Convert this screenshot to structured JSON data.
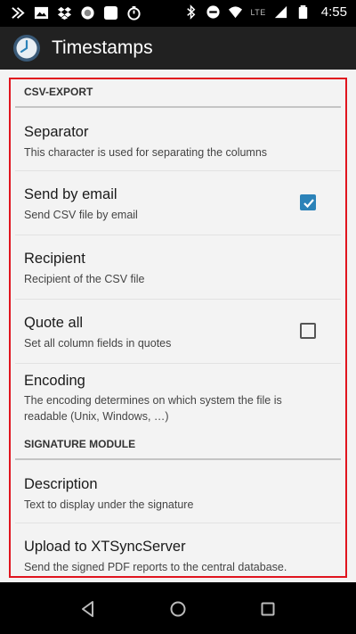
{
  "status_bar": {
    "network": "LTE",
    "time": "4:55",
    "left_icons": [
      "signal-fast-icon",
      "image-icon",
      "dropbox-icon",
      "circle-icon",
      "square-icon",
      "stopwatch-icon"
    ],
    "right_icons": [
      "bluetooth-icon",
      "do-not-disturb-icon",
      "wifi-icon",
      "cell-signal-icon",
      "battery-icon"
    ]
  },
  "app_bar": {
    "title": "Timestamps",
    "icon": "clock-icon"
  },
  "sections": [
    {
      "header": "CSV-EXPORT",
      "items": [
        {
          "title": "Separator",
          "summary": "This character is used for separating the columns",
          "control": "none"
        },
        {
          "title": "Send by email",
          "summary": "Send CSV file by email",
          "control": "checkbox",
          "checked": true
        },
        {
          "title": "Recipient",
          "summary": "Recipient of the CSV file",
          "control": "none"
        },
        {
          "title": "Quote all",
          "summary": "Set all column fields in quotes",
          "control": "checkbox",
          "checked": false
        },
        {
          "title": "Encoding",
          "summary": "The encoding determines on which system the file is readable (Unix, Windows, …)",
          "control": "none"
        }
      ]
    },
    {
      "header": "SIGNATURE MODULE",
      "items": [
        {
          "title": "Description",
          "summary": "Text to display under the signature",
          "control": "none"
        },
        {
          "title": "Upload to XTSyncServer",
          "summary": "Send the signed PDF reports to the central database.",
          "control": "none"
        }
      ]
    }
  ],
  "nav_bar": {
    "buttons": [
      "back-icon",
      "home-icon",
      "recents-icon"
    ]
  },
  "colors": {
    "accent": "#2b82b8",
    "highlight_border": "#e0141e",
    "app_bar": "#212121",
    "background": "#f3f3f3"
  }
}
